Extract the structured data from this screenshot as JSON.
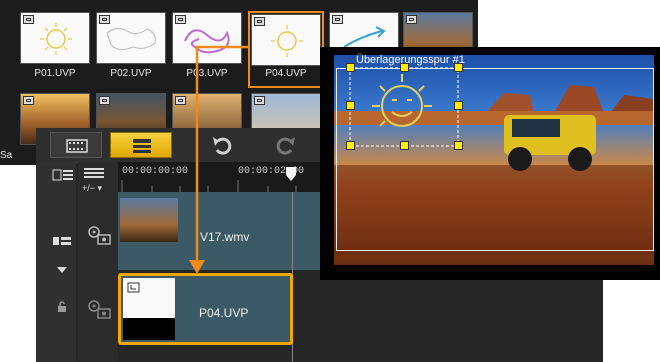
{
  "library": {
    "thumbnails": [
      {
        "label": "P01.UVP"
      },
      {
        "label": "P02.UVP"
      },
      {
        "label": "P03.UVP"
      },
      {
        "label": "P04.UVP"
      },
      {
        "label": ""
      },
      {
        "label": ""
      }
    ],
    "row2_partial_label": "Sa"
  },
  "toolbar": {
    "storyboard_icon": "film-strip-icon",
    "timeline_icon": "timeline-view-icon",
    "undo_icon": "undo-icon",
    "redo_icon": "redo-icon"
  },
  "ruler": {
    "start_timecode": "00:00:00:00",
    "next_timecode": "00:00:02:00",
    "zoom_label": "+/− ▾"
  },
  "tracks": {
    "video_clip_label": "V17.wmv",
    "overlay_clip_label": "P04.UVP"
  },
  "preview": {
    "overlay_title": "Überlagerungsspur #1"
  },
  "colors": {
    "accent_orange": "#f08a1a",
    "selection_yellow": "#f0a800",
    "handle_yellow": "#ffee00",
    "track_blue": "#3b5a66"
  }
}
